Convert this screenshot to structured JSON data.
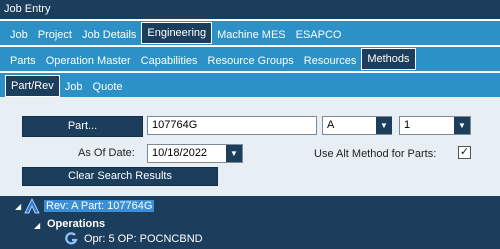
{
  "window": {
    "title": "Job Entry"
  },
  "tabs_main": [
    {
      "label": "Job",
      "active": false
    },
    {
      "label": "Project",
      "active": false
    },
    {
      "label": "Job Details",
      "active": false
    },
    {
      "label": "Engineering",
      "active": true
    },
    {
      "label": "Machine MES",
      "active": false
    },
    {
      "label": "ESAPCO",
      "active": false
    }
  ],
  "tabs_sub": [
    {
      "label": "Parts",
      "active": false
    },
    {
      "label": "Operation Master",
      "active": false
    },
    {
      "label": "Capabilities",
      "active": false
    },
    {
      "label": "Resource Groups",
      "active": false
    },
    {
      "label": "Resources",
      "active": false
    },
    {
      "label": "Methods",
      "active": true
    }
  ],
  "tabs_methods": [
    {
      "label": "Part/Rev",
      "active": true
    },
    {
      "label": "Job",
      "active": false
    },
    {
      "label": "Quote",
      "active": false
    }
  ],
  "search": {
    "part_button": "Part...",
    "part_value": "107764G",
    "rev_value": "A",
    "alt_value": "1",
    "as_of_label": "As Of Date:",
    "as_of_value": "10/18/2022",
    "alt_method_label": "Use Alt Method for Parts:",
    "alt_method_checked": true,
    "checkmark": "✓",
    "clear_button": "Clear Search Results"
  },
  "tree": {
    "root_label": "Rev: A Part: 107764G",
    "operations_label": "Operations",
    "op_label": "Opr: 5 OP: POCNCBND",
    "colors": {
      "background": "#1b3e5c",
      "selected": "#3a8fd6"
    }
  },
  "colors": {
    "header": "#1b3e5c",
    "tabbar": "#2b91c6",
    "panel": "#e7eef4"
  }
}
